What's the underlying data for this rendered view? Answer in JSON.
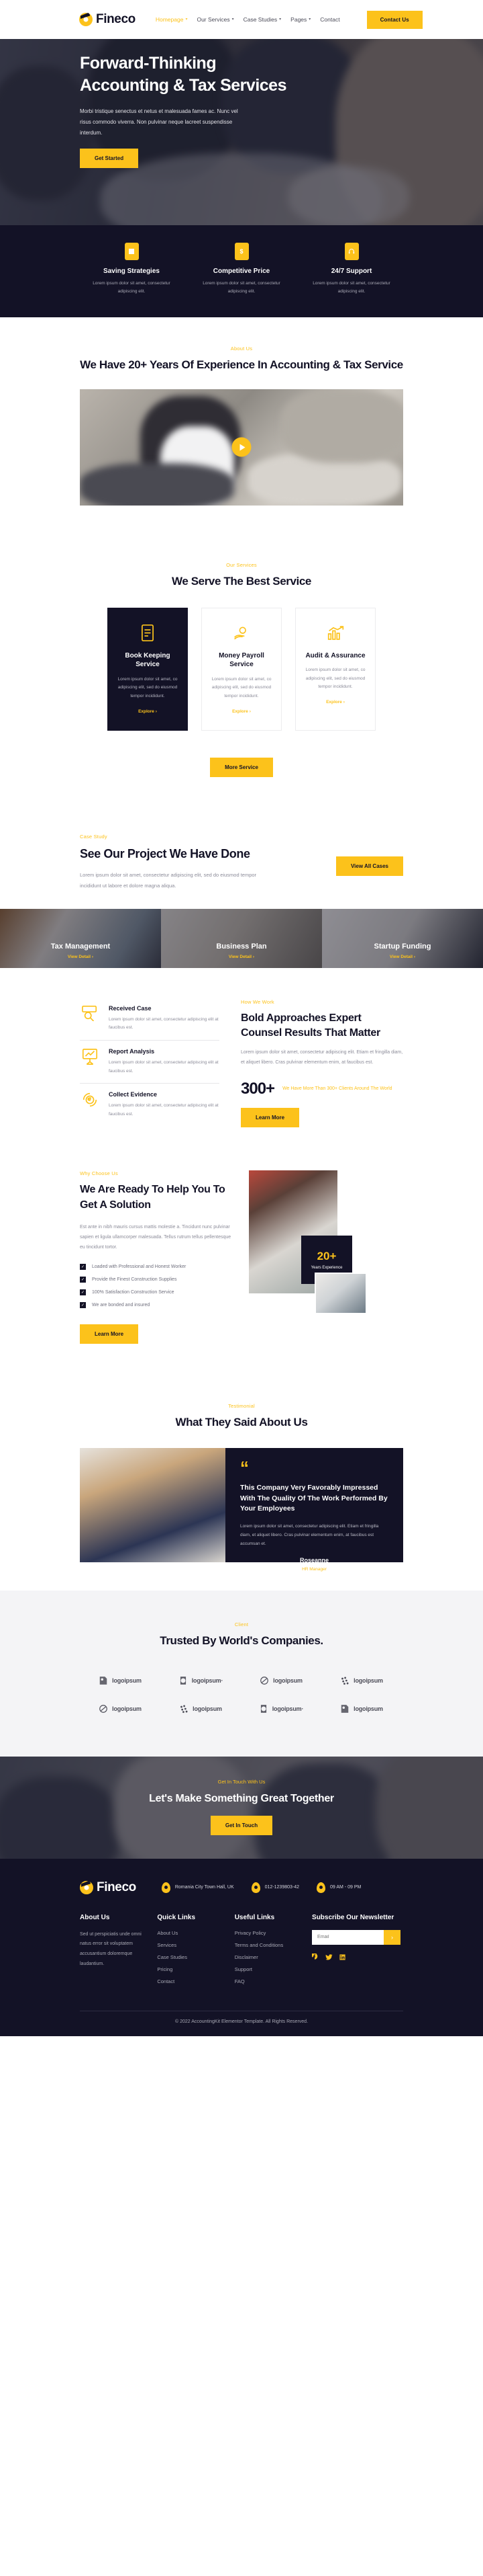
{
  "brand": {
    "name": "Fineco"
  },
  "nav": {
    "links": [
      {
        "label": "Homepage",
        "has_caret": true,
        "active": true
      },
      {
        "label": "Our Services",
        "has_caret": true,
        "active": false
      },
      {
        "label": "Case Studies",
        "has_caret": true,
        "active": false
      },
      {
        "label": "Pages",
        "has_caret": true,
        "active": false
      },
      {
        "label": "Contact",
        "has_caret": false,
        "active": false
      }
    ],
    "cta_label": "Contact Us"
  },
  "hero": {
    "title": "Forward-Thinking Accounting & Tax Services",
    "paragraph": "Morbi tristique senectus et netus et malesuada fames ac. Nunc vel risus commodo viverra. Non pulvinar neque lacreet suspendisse interdum.",
    "button": "Get Started"
  },
  "features": [
    {
      "title": "Saving Strategies",
      "text": "Lorem ipsum dolor sit amet, consectetur adipiscing elit.",
      "icon": "document-icon"
    },
    {
      "title": "Competitive Price",
      "text": "Lorem ipsum dolor sit amet, consectetur adipiscing elit.",
      "icon": "dollar-icon"
    },
    {
      "title": "24/7 Support",
      "text": "Lorem ipsum dolor sit amet, consectetur adipiscing elit.",
      "icon": "headset-icon"
    }
  ],
  "about": {
    "eyebrow": "About Us",
    "title": "We Have 20+ Years Of Experience In Accounting & Tax Service"
  },
  "services": {
    "eyebrow": "Our Services",
    "title": "We Serve The Best Service",
    "items": [
      {
        "name": "Book Keeping Service",
        "text": "Lorem ipsum dolor sit amet, co adipiscing elit, sed do eiusmod tempor incididunt.",
        "link": "Explore",
        "icon": "ledger-icon",
        "dark": true
      },
      {
        "name": "Money Payroll Service",
        "text": "Lorem ipsum dolor sit amet, co adipiscing elit, sed do eiusmod tempor incididunt.",
        "link": "Explore",
        "icon": "hand-money-icon",
        "dark": false
      },
      {
        "name": "Audit & Assurance",
        "text": "Lorem ipsum dolor sit amet, co adipiscing elit, sed do eiusmod tempor incididunt.",
        "link": "Explore",
        "icon": "bar-chart-icon",
        "dark": false
      }
    ],
    "more_button": "More Service"
  },
  "case_study": {
    "eyebrow": "Case Study",
    "title": "See Our Project We Have Done",
    "paragraph": "Lorem ipsum dolor sit amet, consectetur adipiscing elit, sed do eiusmod tempor incididunt ut labore et dolore magna aliqua.",
    "button": "View All Cases",
    "cards": [
      {
        "name": "Tax Management",
        "link": "View Detail"
      },
      {
        "name": "Business Plan",
        "link": "View Detail"
      },
      {
        "name": "Startup Funding",
        "link": "View Detail"
      }
    ]
  },
  "how_we_work": {
    "eyebrow": "How We Work",
    "title": "Bold Approaches Expert Counsel Results That Matter",
    "paragraph": "Lorem ipsum dolor sit amet, consectetur adipiscing elit. Etiam et fringilla diam, et aliquet libero. Cras pulvinar elementum enim, at faucibus est.",
    "stat_number": "300+",
    "stat_caption": "We Have More Than 300+ Clients Around The World",
    "button": "Learn More",
    "steps": [
      {
        "name": "Received Case",
        "text": "Lorem ipsum dolor sit amet, consectetur adipiscing elit at faucibus est.",
        "icon": "finance-search-icon"
      },
      {
        "name": "Report Analysis",
        "text": "Lorem ipsum dolor sit amet, consectetur adipiscing elit at faucibus est.",
        "icon": "presentation-chart-icon"
      },
      {
        "name": "Collect Evidence",
        "text": "Lorem ipsum dolor sit amet, consectetur adipiscing elit at faucibus est.",
        "icon": "currency-cycle-icon"
      }
    ]
  },
  "why_choose": {
    "eyebrow": "Why Choose Us",
    "title": "We Are Ready To Help You To Get A Solution",
    "paragraph": "Est ante in nibh mauris cursus mattis molestie a. Tincidunt nunc pulvinar sapien et ligula ullamcorper malesuada. Tellus rutrum tellus pellentesque eu tincidunt tortor.",
    "checks": [
      "Loaded with Professional and Honest Worker",
      "Provide the Finest Construction Supplies",
      "100% Satisfaction Construction Service",
      "We are bonded and insured"
    ],
    "button": "Learn More",
    "badge_number": "20+",
    "badge_label": "Years Experience"
  },
  "testimonial": {
    "eyebrow": "Testimonial",
    "title": "What They Said About Us",
    "quote_mark": "“",
    "quote_title": "This Company Very Favorably Impressed With The Quality Of The Work Performed By Your Employees",
    "quote_text": "Lorem ipsum dolor sit amet, consectetur adipiscing elit. Etiam et fringilla diam, et aliquet libero. Cras pulvinar elementum enim, at faucibus est accumsan et.",
    "author": "Roseanne",
    "role": "HR Manager"
  },
  "clients": {
    "eyebrow": "Client",
    "title": "Trusted By World's Companies.",
    "logos": [
      {
        "word": "logoipsum",
        "glyph": "logo-square-dot-icon"
      },
      {
        "word": "logoipsum·",
        "glyph": "logo-half-circle-icon"
      },
      {
        "word": "logoipsum",
        "glyph": "logo-ellipse-icon"
      },
      {
        "word": "logoipsum",
        "glyph": "logo-dots-icon"
      },
      {
        "word": "logoipsum",
        "glyph": "logo-ellipse-icon"
      },
      {
        "word": "logoipsum",
        "glyph": "logo-dots-icon"
      },
      {
        "word": "logoipsum·",
        "glyph": "logo-half-circle-icon"
      },
      {
        "word": "logoipsum",
        "glyph": "logo-square-dot-icon"
      }
    ]
  },
  "cta": {
    "eyebrow": "Get In Touch With Us",
    "title": "Let's Make Something Great Together",
    "button": "Get In Touch"
  },
  "footer": {
    "contacts": [
      {
        "text": "Romania City Town Hall, UK",
        "icon": "location-pin-icon"
      },
      {
        "text": "012-1239803-42",
        "icon": "phone-icon"
      },
      {
        "text": "09 AM - 09 PM",
        "icon": "clock-icon"
      }
    ],
    "about": {
      "heading": "About Us",
      "text": "Sed ut perspiciatis unde omni natus error sit voluptatem accusantium doloremque laudantium."
    },
    "quick_links": {
      "heading": "Quick Links",
      "items": [
        "About Us",
        "Services",
        "Case Studies",
        "Pricing",
        "Contact"
      ]
    },
    "useful_links": {
      "heading": "Useful Links",
      "items": [
        "Privacy Policy",
        "Terms and Conditions",
        "Disclaimer",
        "Support",
        "FAQ"
      ]
    },
    "newsletter": {
      "heading": "Subscribe Our Newsletter",
      "placeholder": "Email",
      "value": "",
      "submit": "›",
      "socials": [
        "facebook-icon",
        "twitter-icon",
        "linkedin-icon"
      ]
    },
    "copyright": "© 2022 AccountingKit Elementor Template. All Rights Reserved."
  },
  "colors": {
    "accent": "#FCC21B",
    "dark": "#131226",
    "muted": "#8c8c99",
    "light_bg": "#f4f4f6"
  }
}
